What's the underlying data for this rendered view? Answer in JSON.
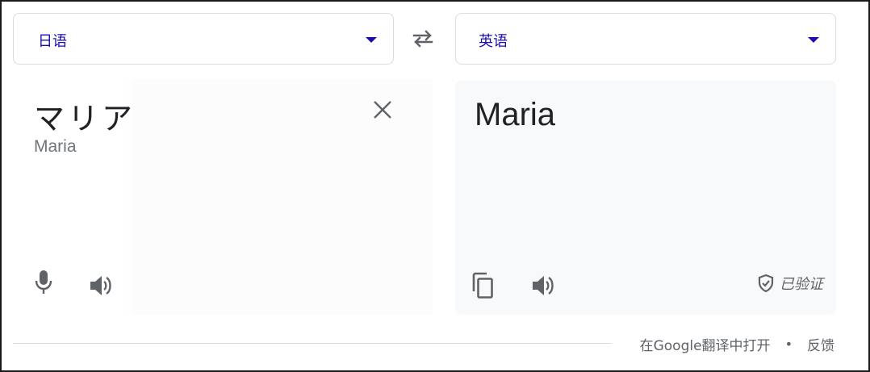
{
  "source_lang": {
    "label": "日语"
  },
  "target_lang": {
    "label": "英语"
  },
  "source": {
    "text": "マリア",
    "romanization": "Maria"
  },
  "target": {
    "text": "Maria",
    "verified_label": "已验证"
  },
  "footer": {
    "open_in_google_translate": "在Google翻译中打开",
    "separator": "•",
    "feedback": "反馈"
  },
  "icons": {
    "swap": "swap-arrows-icon",
    "dropdown": "chevron-down-icon",
    "clear": "close-icon",
    "mic": "microphone-icon",
    "speaker": "speaker-icon",
    "copy": "copy-icon",
    "verified": "shield-check-icon"
  },
  "colors": {
    "language_label": "#1a0dab",
    "icon_gray": "#5f6368",
    "panel_background": "#f8f9fa",
    "border": "#dadce0"
  }
}
